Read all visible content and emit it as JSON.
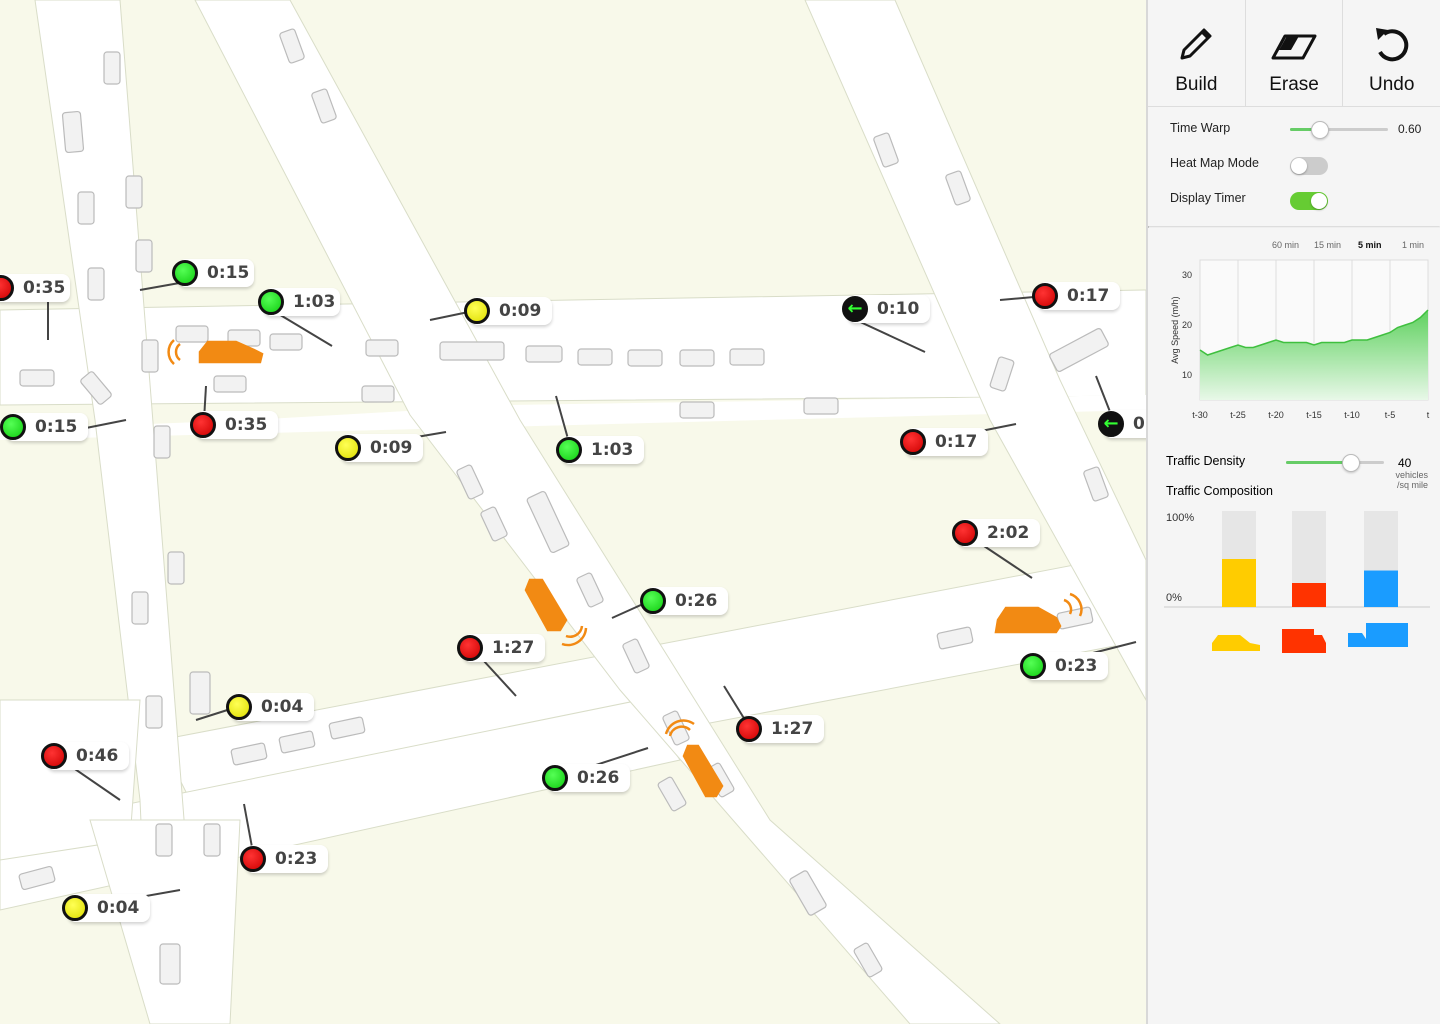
{
  "signals": [
    {
      "id": "s1",
      "time": "0:35",
      "color": "red"
    },
    {
      "id": "s2",
      "time": "0:15",
      "color": "green"
    },
    {
      "id": "s3",
      "time": "1:03",
      "color": "green"
    },
    {
      "id": "s4",
      "time": "0:09",
      "color": "yellow"
    },
    {
      "id": "s5",
      "time": "0:10",
      "color": "arrow"
    },
    {
      "id": "s6",
      "time": "0:17",
      "color": "red"
    },
    {
      "id": "s7",
      "time": "0:15",
      "color": "green"
    },
    {
      "id": "s8",
      "time": "0:35",
      "color": "red"
    },
    {
      "id": "s9",
      "time": "0:09",
      "color": "yellow"
    },
    {
      "id": "s10",
      "time": "1:03",
      "color": "green"
    },
    {
      "id": "s11",
      "time": "0:17",
      "color": "red"
    },
    {
      "id": "s12",
      "time": "0",
      "color": "arrow"
    },
    {
      "id": "s13",
      "time": "2:02",
      "color": "red"
    },
    {
      "id": "s14",
      "time": "0:26",
      "color": "green"
    },
    {
      "id": "s15",
      "time": "1:27",
      "color": "red"
    },
    {
      "id": "s16",
      "time": "0:23",
      "color": "green"
    },
    {
      "id": "s17",
      "time": "0:04",
      "color": "yellow"
    },
    {
      "id": "s18",
      "time": "0:46",
      "color": "red"
    },
    {
      "id": "s19",
      "time": "1:27",
      "color": "red"
    },
    {
      "id": "s20",
      "time": "0:26",
      "color": "green"
    },
    {
      "id": "s21",
      "time": "0:23",
      "color": "red"
    },
    {
      "id": "s22",
      "time": "0:04",
      "color": "yellow"
    }
  ],
  "toolbar": {
    "build": "Build",
    "erase": "Erase",
    "undo": "Undo"
  },
  "controls": {
    "time_warp_label": "Time Warp",
    "time_warp_value": "0.60",
    "time_warp_level": 0.6,
    "heat_map_label": "Heat Map Mode",
    "heat_map_on": false,
    "display_timer_label": "Display Timer",
    "display_timer_on": true
  },
  "speed_chart": {
    "ranges": [
      "60 min",
      "15 min",
      "5 min",
      "1 min"
    ],
    "active_range": "5 min",
    "ylabel": "Avg Speed (m/h)"
  },
  "chart_data": {
    "type": "area",
    "ylabel": "Avg Speed (m/h)",
    "ylim": [
      5,
      33
    ],
    "yticks": [
      10,
      20,
      30
    ],
    "xticks": [
      "t-30",
      "t-25",
      "t-20",
      "t-15",
      "t-10",
      "t-5",
      "t"
    ],
    "x": [
      -30,
      -29,
      -28,
      -27,
      -26,
      -25,
      -24,
      -23,
      -22,
      -21,
      -20,
      -19,
      -18,
      -17,
      -16,
      -15,
      -14,
      -13,
      -12,
      -11,
      -10,
      -9,
      -8,
      -7,
      -6,
      -5,
      -4,
      -3,
      -2,
      -1,
      0
    ],
    "values": [
      15,
      14,
      14.5,
      15,
      15.5,
      16,
      15.5,
      15.5,
      16,
      16.5,
      17,
      16.5,
      16.5,
      16.5,
      16.5,
      16,
      16.5,
      16.5,
      16.5,
      16.5,
      17,
      17,
      17,
      17.5,
      18,
      18.5,
      19.5,
      20,
      20.5,
      21.5,
      23
    ],
    "color": "#5fd15f"
  },
  "density": {
    "label": "Traffic Density",
    "value": "40",
    "unit_line1": "vehicles",
    "unit_line2": "/sq mile",
    "level": 0.65
  },
  "composition": {
    "label": "Traffic Composition",
    "y_top": "100%",
    "y_bottom": "0%",
    "bars": [
      {
        "name": "car",
        "value": 0.5,
        "color": "#ffcc00"
      },
      {
        "name": "van",
        "value": 0.25,
        "color": "#ff3300"
      },
      {
        "name": "truck",
        "value": 0.38,
        "color": "#1a9cff"
      }
    ]
  }
}
